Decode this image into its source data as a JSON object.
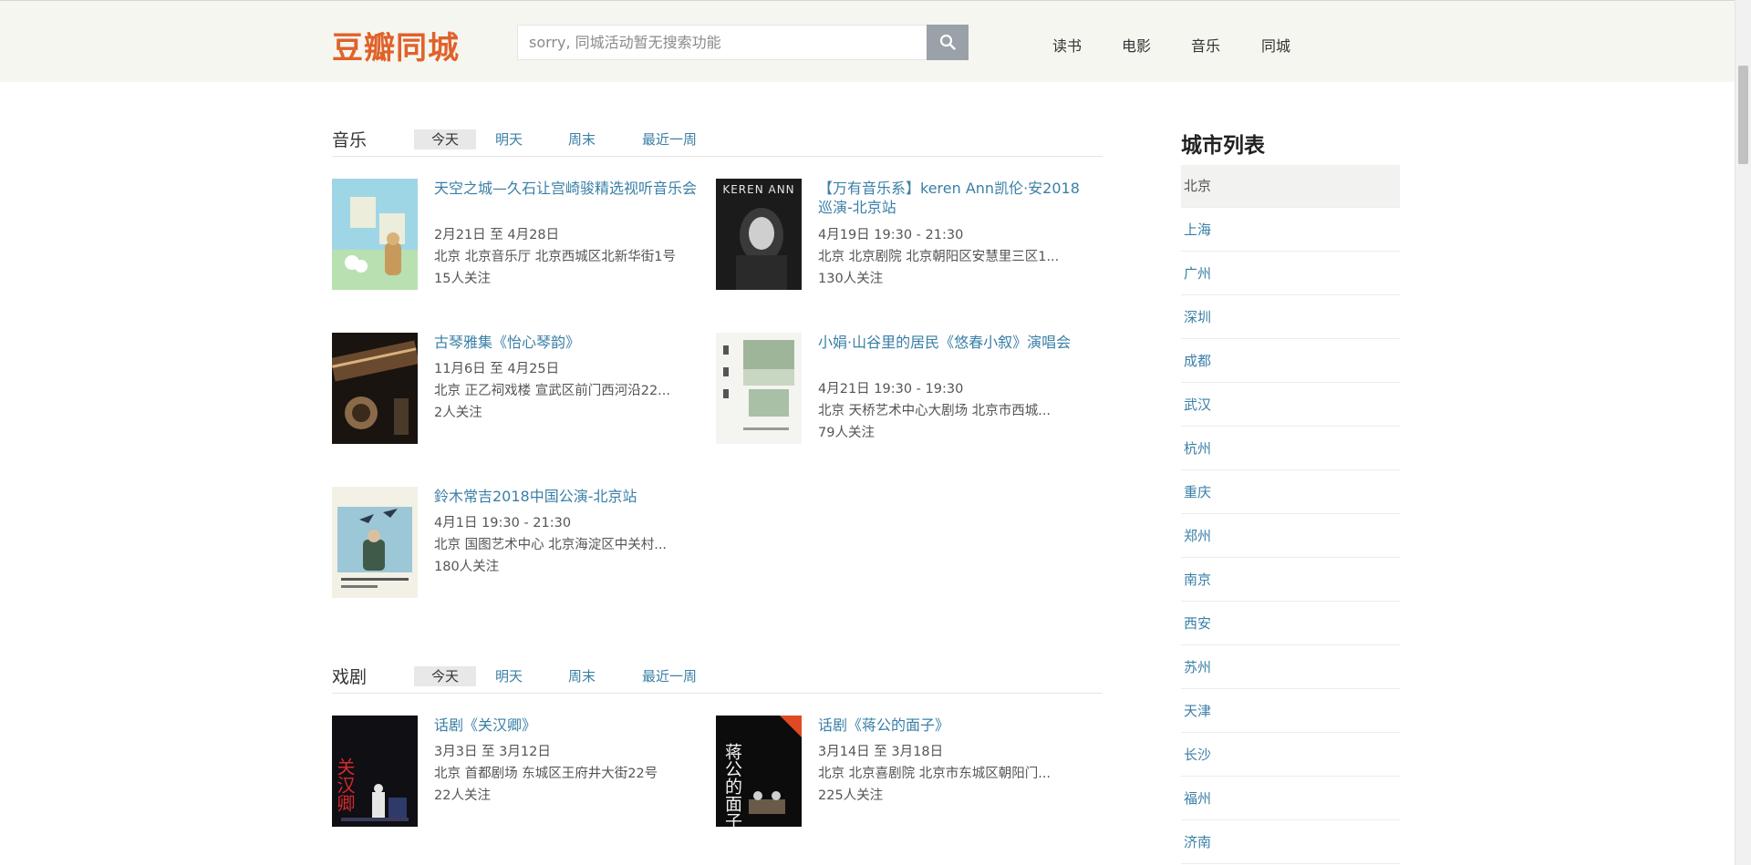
{
  "header": {
    "logo": "豆瓣同城",
    "search_placeholder": "sorry, 同城活动暂无搜索功能",
    "nav": [
      "读书",
      "电影",
      "音乐",
      "同城"
    ]
  },
  "sections": [
    {
      "title": "音乐",
      "tabs": [
        "今天",
        "明天",
        "周末",
        "最近一周"
      ],
      "events": [
        {
          "title": "天空之城—久石让宫崎骏精选视听音乐会",
          "date": "2月21日 至 4月28日",
          "venue": "北京 北京音乐厅 北京西城区北新华街1号",
          "followers": "15人关注"
        },
        {
          "title": "【万有音乐系】keren Ann凯伦·安2018巡演-北京站",
          "date": "4月19日 19:30 - 21:30",
          "venue": "北京 北京剧院 北京朝阳区安慧里三区1...",
          "followers": "130人关注"
        },
        {
          "title": "古琴雅集《怡心琴韵》",
          "date": "11月6日 至 4月25日",
          "venue": "北京 正乙祠戏楼 宣武区前门西河沿22...",
          "followers": "2人关注"
        },
        {
          "title": "小娟·山谷里的居民《悠春小叙》演唱会",
          "date": "4月21日 19:30 - 19:30",
          "venue": "北京 天桥艺术中心大剧场 北京市西城...",
          "followers": "79人关注"
        },
        {
          "title": "鈴木常吉2018中国公演-北京站",
          "date": "4月1日 19:30 - 21:30",
          "venue": "北京 国图艺术中心 北京海淀区中关村...",
          "followers": "180人关注"
        }
      ]
    },
    {
      "title": "戏剧",
      "tabs": [
        "今天",
        "明天",
        "周末",
        "最近一周"
      ],
      "events": [
        {
          "title": "话剧《关汉卿》",
          "date": "3月3日 至 3月12日",
          "venue": "北京 首都剧场 东城区王府井大街22号",
          "followers": "22人关注"
        },
        {
          "title": "话剧《蒋公的面子》",
          "date": "3月14日 至 3月18日",
          "venue": "北京 北京喜剧院 北京市东城区朝阳门...",
          "followers": "225人关注"
        }
      ]
    }
  ],
  "poster_text": {
    "keren": "KEREN ANN",
    "guanhanqing": "关汉卿",
    "jianggong": "蒋公的面子"
  },
  "sidebar": {
    "title": "城市列表",
    "cities": [
      "北京",
      "上海",
      "广州",
      "深圳",
      "成都",
      "武汉",
      "杭州",
      "重庆",
      "郑州",
      "南京",
      "西安",
      "苏州",
      "天津",
      "长沙",
      "福州",
      "济南"
    ]
  }
}
